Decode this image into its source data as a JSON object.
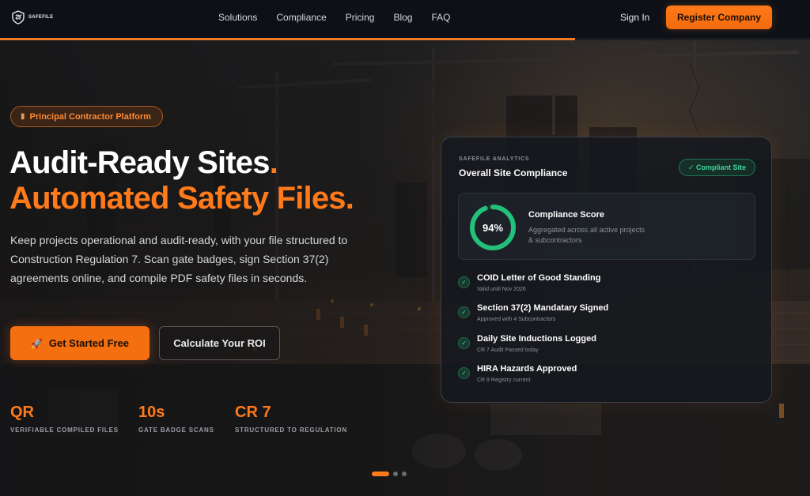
{
  "nav": {
    "brand": "SAFEFILE",
    "links": [
      "Solutions",
      "Compliance",
      "Pricing",
      "Blog",
      "FAQ"
    ],
    "sign_in": "Sign In",
    "register": "Register Company"
  },
  "slider_progress": 0.71,
  "hero": {
    "badge": "Principal Contractor Platform",
    "headline_line1": "Audit-Ready Sites",
    "headline_line1_dot": ".",
    "headline_line2": "Automated Safety Files.",
    "lede": "Keep projects operational and audit-ready, with your file structured to Construction Regulation 7. Scan gate badges, sign Section 37(2) agreements online, and compile PDF safety files in seconds.",
    "cta_primary": "Get Started Free",
    "cta_secondary": "Calculate Your ROI",
    "stats": [
      {
        "value": "QR",
        "label": "VERIFIABLE COMPILED FILES"
      },
      {
        "value": "10s",
        "label": "GATE BADGE SCANS"
      },
      {
        "value": "CR 7",
        "label": "STRUCTURED TO REGULATION"
      }
    ],
    "slides": {
      "count": 3,
      "active": 0
    }
  },
  "card": {
    "eyebrow": "SAFEFILE ANALYTICS",
    "title": "Overall Site Compliance",
    "status": "✓ Compliant Site",
    "score": {
      "value": "94%",
      "percent": 94,
      "title": "Compliance Score",
      "description": "Aggregated across all active projects & subcontractors"
    },
    "items": [
      {
        "title": "COID Letter of Good Standing",
        "subtitle": "Valid until Nov 2026"
      },
      {
        "title": "Section 37(2) Mandatary Signed",
        "subtitle": "Approved with 4 Subcontractors"
      },
      {
        "title": "Daily Site Inductions Logged",
        "subtitle": "CR 7 Audit Passed today"
      },
      {
        "title": "HIRA Hazards Approved",
        "subtitle": "CR 9 Registry current"
      }
    ]
  },
  "colors": {
    "accent": "#ff7a1a",
    "success": "#3fd79b",
    "nav_bg": "#0d1117"
  },
  "icons": {
    "badge": "building-icon",
    "cta_primary": "rocket-icon",
    "check": "check-circle-icon"
  }
}
